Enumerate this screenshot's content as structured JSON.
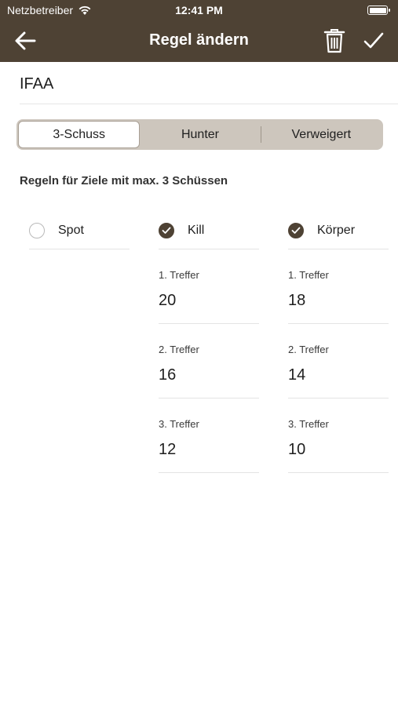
{
  "status": {
    "carrier": "Netzbetreiber",
    "time": "12:41 PM"
  },
  "nav": {
    "title": "Regel ändern"
  },
  "rule": {
    "name": "IFAA"
  },
  "tabs": [
    {
      "label": "3-Schuss",
      "active": true
    },
    {
      "label": "Hunter",
      "active": false
    },
    {
      "label": "Verweigert",
      "active": false
    }
  ],
  "section_title": "Regeln für Ziele mit max. 3 Schüssen",
  "columns": [
    {
      "label": "Spot",
      "checked": false,
      "hits": []
    },
    {
      "label": "Kill",
      "checked": true,
      "hits": [
        {
          "label": "1. Treffer",
          "value": "20"
        },
        {
          "label": "2. Treffer",
          "value": "16"
        },
        {
          "label": "3. Treffer",
          "value": "12"
        }
      ]
    },
    {
      "label": "Körper",
      "checked": true,
      "hits": [
        {
          "label": "1. Treffer",
          "value": "18"
        },
        {
          "label": "2. Treffer",
          "value": "14"
        },
        {
          "label": "3. Treffer",
          "value": "10"
        }
      ]
    }
  ],
  "colors": {
    "header": "#4e4234",
    "segment_bg": "#cdc6bd",
    "checkbox": "#4e4234"
  },
  "icons": {
    "back": "arrow-left-icon",
    "delete": "trash-icon",
    "confirm": "checkmark-icon",
    "wifi": "wifi-icon",
    "battery": "battery-icon"
  }
}
